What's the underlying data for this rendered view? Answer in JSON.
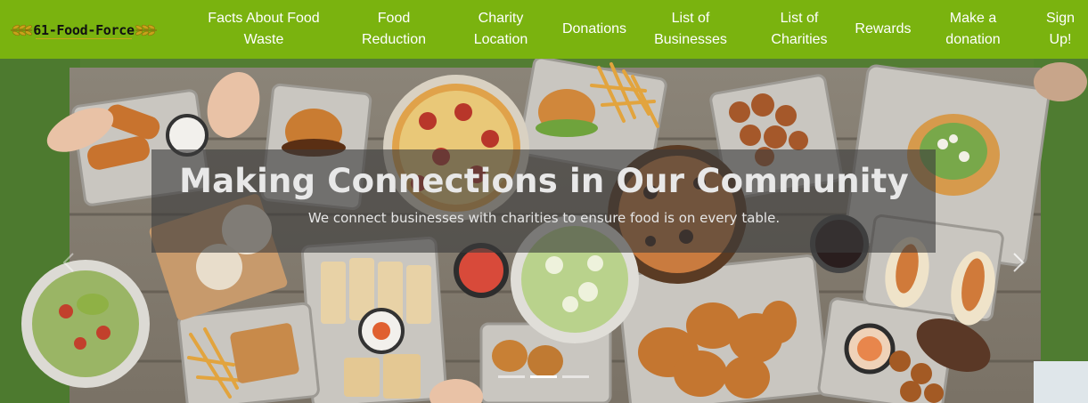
{
  "brand": {
    "name": "61-Food-Force"
  },
  "nav": {
    "items": [
      {
        "label": "Facts About Food Waste"
      },
      {
        "label": "Food Reduction"
      },
      {
        "label": "Charity Location"
      },
      {
        "label": "Donations"
      },
      {
        "label": "List of Businesses"
      },
      {
        "label": "List of Charities"
      },
      {
        "label": "Rewards"
      },
      {
        "label": "Make a donation"
      },
      {
        "label": "Sign Up!"
      }
    ]
  },
  "carousel": {
    "title": "Making Connections in Our Community",
    "subtitle": "We connect businesses with charities to ensure food is on every table.",
    "active_slide": 2,
    "slide_count": 3
  },
  "colors": {
    "navbar": "#7ab30f",
    "nav_text": "#ffffff",
    "caption_overlay": "#3c3c3c"
  },
  "icons": {
    "brand": "wheat-laurel-icon",
    "next": "chevron-right-icon",
    "prev": "chevron-left-icon"
  }
}
